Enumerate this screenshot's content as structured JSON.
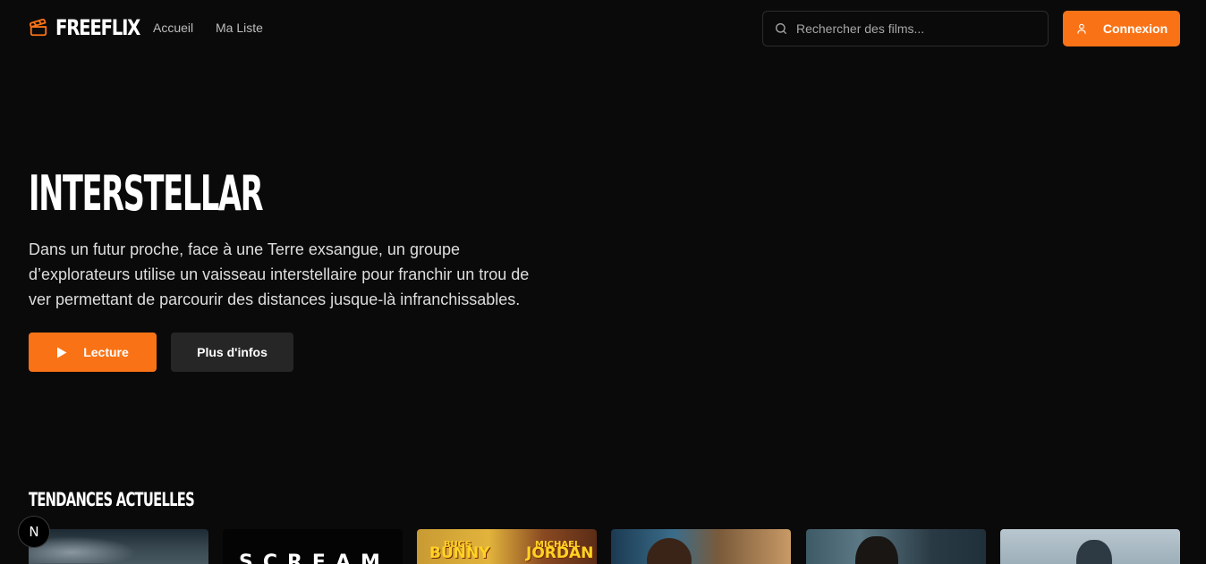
{
  "header": {
    "brand": "FREEFLIX",
    "logo_icon": "clapperboard-icon",
    "nav": [
      {
        "label": "Accueil"
      },
      {
        "label": "Ma Liste"
      }
    ],
    "search": {
      "placeholder": "Rechercher des films...",
      "value": "",
      "icon": "search-icon"
    },
    "login": {
      "label": "Connexion",
      "icon": "user-icon"
    }
  },
  "hero": {
    "title": "INTERSTELLAR",
    "description": "Dans un futur proche, face à une Terre exsangue, un groupe d’explorateurs utilise un vaisseau interstellaire pour franchir un trou de ver permettant de parcourir des distances jusque-là infranchissables.",
    "play_label": "Lecture",
    "play_icon": "play-icon",
    "info_label": "Plus d'infos"
  },
  "trending": {
    "title": "TENDANCES ACTUELLES",
    "posters": [
      {
        "text": ""
      },
      {
        "text": "SCREAM"
      },
      {
        "text_lines": [
          "BUGS",
          "BUNNY",
          "MICHAEL",
          "JORDAN"
        ]
      },
      {
        "text": ""
      },
      {
        "text": ""
      },
      {
        "text": ""
      }
    ]
  },
  "dev_badge": {
    "label": "N"
  },
  "colors": {
    "accent": "#f97316",
    "background": "#0b0a0b",
    "secondary_button": "#262626"
  }
}
